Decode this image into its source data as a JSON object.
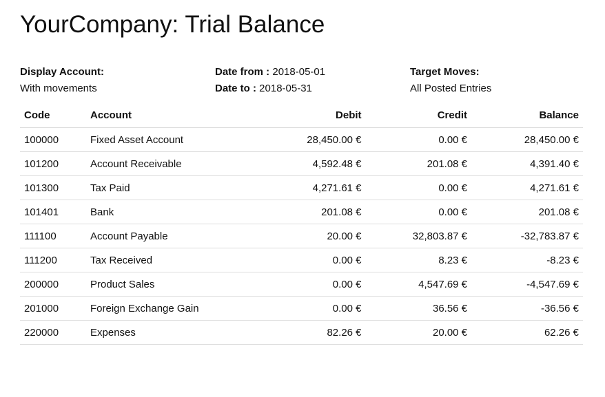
{
  "report": {
    "title": "YourCompany: Trial Balance"
  },
  "info": {
    "display_account_label": "Display Account:",
    "display_account_value": "With movements",
    "date_from_label": "Date from :",
    "date_from_value": "2018-05-01",
    "date_to_label": "Date to :",
    "date_to_value": "2018-05-31",
    "target_moves_label": "Target Moves:",
    "target_moves_value": "All Posted Entries"
  },
  "table": {
    "headers": {
      "code": "Code",
      "account": "Account",
      "debit": "Debit",
      "credit": "Credit",
      "balance": "Balance"
    },
    "rows": [
      {
        "code": "100000",
        "account": "Fixed Asset Account",
        "debit": "28,450.00 €",
        "credit": "0.00 €",
        "balance": "28,450.00 €"
      },
      {
        "code": "101200",
        "account": "Account Receivable",
        "debit": "4,592.48 €",
        "credit": "201.08 €",
        "balance": "4,391.40 €"
      },
      {
        "code": "101300",
        "account": "Tax Paid",
        "debit": "4,271.61 €",
        "credit": "0.00 €",
        "balance": "4,271.61 €"
      },
      {
        "code": "101401",
        "account": "Bank",
        "debit": "201.08 €",
        "credit": "0.00 €",
        "balance": "201.08 €"
      },
      {
        "code": "111100",
        "account": "Account Payable",
        "debit": "20.00 €",
        "credit": "32,803.87 €",
        "balance": "-32,783.87 €"
      },
      {
        "code": "111200",
        "account": "Tax Received",
        "debit": "0.00 €",
        "credit": "8.23 €",
        "balance": "-8.23 €"
      },
      {
        "code": "200000",
        "account": "Product Sales",
        "debit": "0.00 €",
        "credit": "4,547.69 €",
        "balance": "-4,547.69 €"
      },
      {
        "code": "201000",
        "account": "Foreign Exchange Gain",
        "debit": "0.00 €",
        "credit": "36.56 €",
        "balance": "-36.56 €"
      },
      {
        "code": "220000",
        "account": "Expenses",
        "debit": "82.26 €",
        "credit": "20.00 €",
        "balance": "62.26 €"
      }
    ]
  }
}
